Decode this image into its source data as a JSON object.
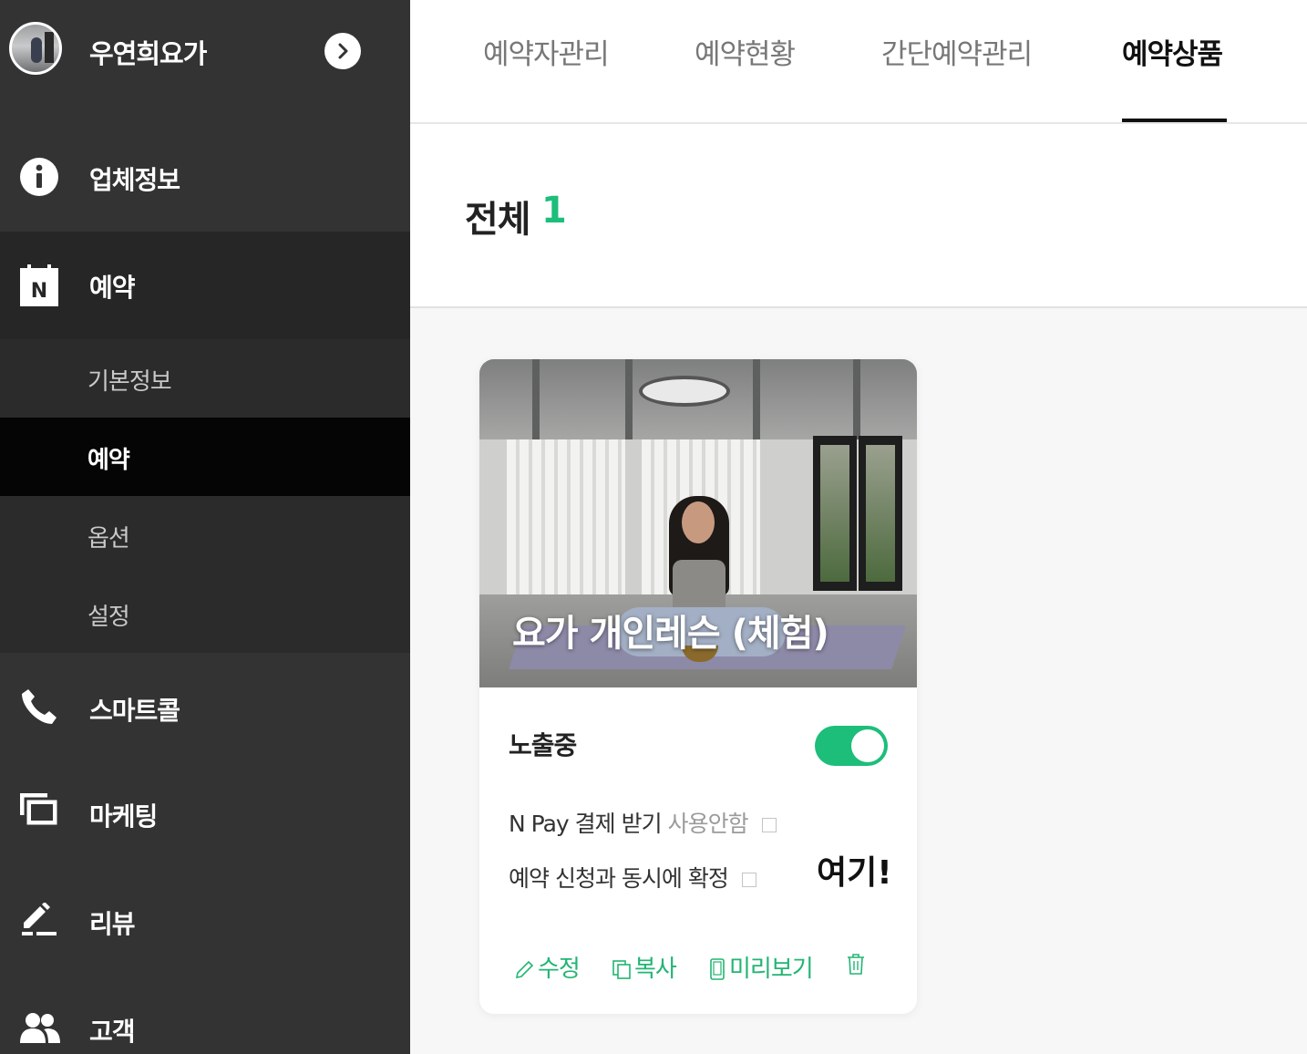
{
  "sidebar": {
    "brand_name": "우연희요가",
    "menu": {
      "info": "업체정보",
      "reservation": "예약",
      "smartcall": "스마트콜",
      "marketing": "마케팅",
      "review": "리뷰",
      "customer": "고객"
    },
    "reservation_icon_letter": "N",
    "submenu": {
      "basic_info": "기본정보",
      "reservation": "예약",
      "options": "옵션",
      "settings": "설정"
    }
  },
  "tabs": {
    "booker_management": "예약자관리",
    "booking_status": "예약현황",
    "simple_booking": "간단예약관리",
    "booking_products": "예약상품"
  },
  "summary": {
    "label": "전체",
    "count": "1"
  },
  "product_card": {
    "title": "요가 개인레슨 (체험)",
    "status_label": "노출중",
    "toggle_on": true,
    "npay_label": "N Pay 결제 받기",
    "npay_state": "사용안함",
    "instant_confirm_label": "예약 신청과 동시에 확정",
    "annotation": "여기!",
    "actions": {
      "edit": "수정",
      "copy": "복사",
      "preview": "미리보기"
    }
  },
  "colors": {
    "accent": "#1dbe7a",
    "sidebar_bg": "#333333",
    "sidebar_active": "#050505"
  },
  "icons": [
    "info-icon",
    "calendar-n-icon",
    "phone-icon",
    "marketing-icon",
    "pencil-icon",
    "users-icon",
    "chevron-right-icon",
    "edit-icon",
    "copy-icon",
    "mobile-preview-icon",
    "trash-icon"
  ]
}
